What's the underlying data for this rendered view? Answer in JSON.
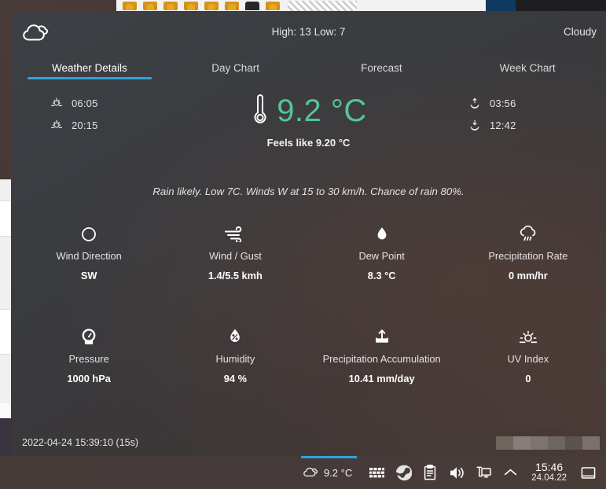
{
  "window": {
    "logo_icon": "cloud-icon",
    "high_low": "High: 13 Low: 7",
    "condition": "Cloudy"
  },
  "tabs": [
    {
      "label": "Weather Details",
      "active": true
    },
    {
      "label": "Day Chart",
      "active": false
    },
    {
      "label": "Forecast",
      "active": false
    },
    {
      "label": "Week Chart",
      "active": false
    }
  ],
  "accent": {
    "tab_underline": "#33a2dd",
    "temperature": "#52c696"
  },
  "current": {
    "sun": [
      {
        "icon": "sunrise-icon",
        "time": "06:05"
      },
      {
        "icon": "sunset-icon",
        "time": "20:15"
      }
    ],
    "moon": [
      {
        "icon": "moonrise-icon",
        "time": "03:56"
      },
      {
        "icon": "moonset-icon",
        "time": "12:42"
      }
    ],
    "thermometer_icon": "thermometer-icon",
    "temperature": "9.2 °C",
    "feels_like": "Feels like 9.20 °C"
  },
  "summary": "Rain likely. Low 7C. Winds W at 15 to 30 km/h. Chance of rain 80%.",
  "details": [
    {
      "icon": "wind-direction-icon",
      "label": "Wind Direction",
      "value": "SW"
    },
    {
      "icon": "wind-icon",
      "label": "Wind / Gust",
      "value": "1.4/5.5 kmh"
    },
    {
      "icon": "dew-point-icon",
      "label": "Dew Point",
      "value": "8.3 °C"
    },
    {
      "icon": "precipitation-rate-icon",
      "label": "Precipitation Rate",
      "value": "0 mm/hr"
    },
    {
      "icon": "pressure-icon",
      "label": "Pressure",
      "value": "1000 hPa"
    },
    {
      "icon": "humidity-icon",
      "label": "Humidity",
      "value": "94 %"
    },
    {
      "icon": "precipitation-accumulation-icon",
      "label": "Precipitation Accumulation",
      "value": "10.41 mm/day"
    },
    {
      "icon": "uv-index-icon",
      "label": "UV Index",
      "value": "0"
    }
  ],
  "status": {
    "timestamp": "2022-04-24 15:39:10 (15s)",
    "blocks": [
      "#6f6660",
      "#867e78",
      "#7d756f",
      "#6e6661",
      "#5b534e",
      "#7a716b"
    ]
  },
  "taskbar": {
    "weather_icon": "cloud-icon",
    "weather_temp": "9.2 °C",
    "tray_icons": [
      "keyboard-icon",
      "steam-icon",
      "clipboard-icon",
      "volume-icon",
      "network-icon",
      "chevron-up-icon"
    ],
    "clock_time": "15:46",
    "clock_date": "24.04.22",
    "show_desktop_icon": "show-desktop-icon"
  }
}
